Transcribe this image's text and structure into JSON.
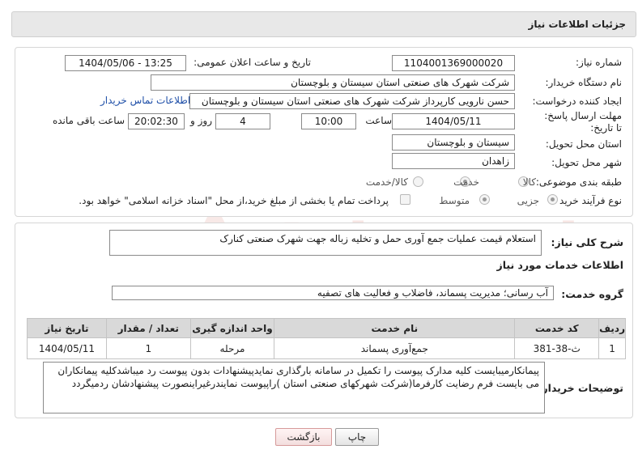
{
  "header": {
    "title": "جزئیات اطلاعات نیاز"
  },
  "form": {
    "need_number_label": "شماره نیاز:",
    "need_number": "1104001369000020",
    "announce_label": "تاریخ و ساعت اعلان عمومی:",
    "announce_value": "1404/05/06 - 13:25",
    "buyer_org_label": "نام دستگاه خریدار:",
    "buyer_org": "شرکت شهرک های صنعتی استان سیستان و بلوچستان",
    "creator_label": "ایجاد کننده درخواست:",
    "creator": "حسن نارویی کارپرداز شرکت شهرک های صنعتی استان سیستان و بلوچستان",
    "contact_link": "اطلاعات تماس خریدار",
    "deadline_label": "مهلت ارسال پاسخ: تا تاریخ:",
    "deadline_date": "1404/05/11",
    "time_label": "ساعت",
    "deadline_time": "10:00",
    "days": "4",
    "days_label": "روز و",
    "remaining": "20:02:30",
    "remaining_label": "ساعت باقی مانده",
    "province_label": "استان محل تحویل:",
    "province": "سیستان و بلوچستان",
    "city_label": "شهر محل تحویل:",
    "city": "زاهدان",
    "category_label": "طبقه بندی موضوعی:",
    "category_options": [
      "کالا",
      "خدمت",
      "کالا/خدمت"
    ],
    "category_selected": "خدمت",
    "process_label": "نوع فرآیند خرید :",
    "process_options": [
      "جزیی",
      "متوسط"
    ],
    "process_selected": "جزیی",
    "payment_note": "پرداخت تمام یا بخشی از مبلغ خرید،از محل \"اسناد خزانه اسلامی\" خواهد بود."
  },
  "description": {
    "label": "شرح کلی نیاز:",
    "text": "استعلام قیمت عملیات جمع آوری حمل و تخلیه زباله جهت شهرک صنعتی کنارک"
  },
  "services": {
    "section_title": "اطلاعات خدمات مورد نیاز",
    "group_label": "گروه خدمت:",
    "group_value": "آب رسانی؛ مدیریت پسماند، فاضلاب و فعالیت های تصفیه",
    "columns": [
      "ردیف",
      "کد خدمت",
      "نام خدمت",
      "واحد اندازه گیری",
      "تعداد / مقدار",
      "تاریخ نیاز"
    ],
    "rows": [
      [
        "1",
        "ث-38-381",
        "جمع‌آوری پسماند",
        "مرحله",
        "1",
        "1404/05/11"
      ]
    ]
  },
  "buyer_notes": {
    "label": "توضیحات خریدار:",
    "text": "پیمانکارمیبایست کلیه مدارک پیوست را تکمیل در سامانه بارگذاری نمایدپیشنهادات بدون پیوست رد میباشدکلیه پیمانکاران می بایست فرم رضایت کارفرما(شرکت شهرکهای صنعتی استان )راپیوست نمایندرغیراینصورت پیشنهادشان ردمیگردد"
  },
  "buttons": {
    "print": "چاپ",
    "back": "بازگشت"
  },
  "watermark_text": "AriaTender.neT",
  "colors": {
    "link": "#1f4fa8",
    "header_bg": "#e8e8e8",
    "watermark": "#c0392b"
  }
}
